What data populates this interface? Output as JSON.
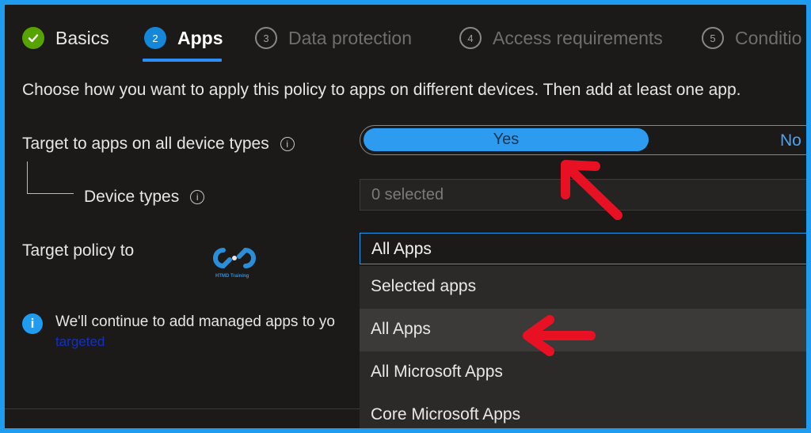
{
  "steps": [
    {
      "number": "",
      "label": "Basics",
      "state": "done"
    },
    {
      "number": "2",
      "label": "Apps",
      "state": "active"
    },
    {
      "number": "3",
      "label": "Data protection",
      "state": "todo"
    },
    {
      "number": "4",
      "label": "Access requirements",
      "state": "todo"
    },
    {
      "number": "5",
      "label": "Conditio",
      "state": "todo"
    }
  ],
  "intro": "Choose how you want to apply this policy to apps on different devices. Then add at least one app.",
  "target_all": {
    "label": "Target to apps on all device types",
    "yes": "Yes",
    "no": "No"
  },
  "device_types": {
    "label": "Device types",
    "placeholder": "0 selected"
  },
  "target_policy": {
    "label": "Target policy to",
    "value": "All Apps",
    "options": [
      "Selected apps",
      "All Apps",
      "All Microsoft Apps",
      "Core Microsoft Apps"
    ],
    "selected_index": 1
  },
  "logo_text": "HTMD Training",
  "info_banner": {
    "text": "We'll continue to add managed apps to yo",
    "link": "targeted"
  },
  "colors": {
    "accent": "#1f9bf0",
    "done_green": "#57a300",
    "annotation_red": "#e81123"
  }
}
